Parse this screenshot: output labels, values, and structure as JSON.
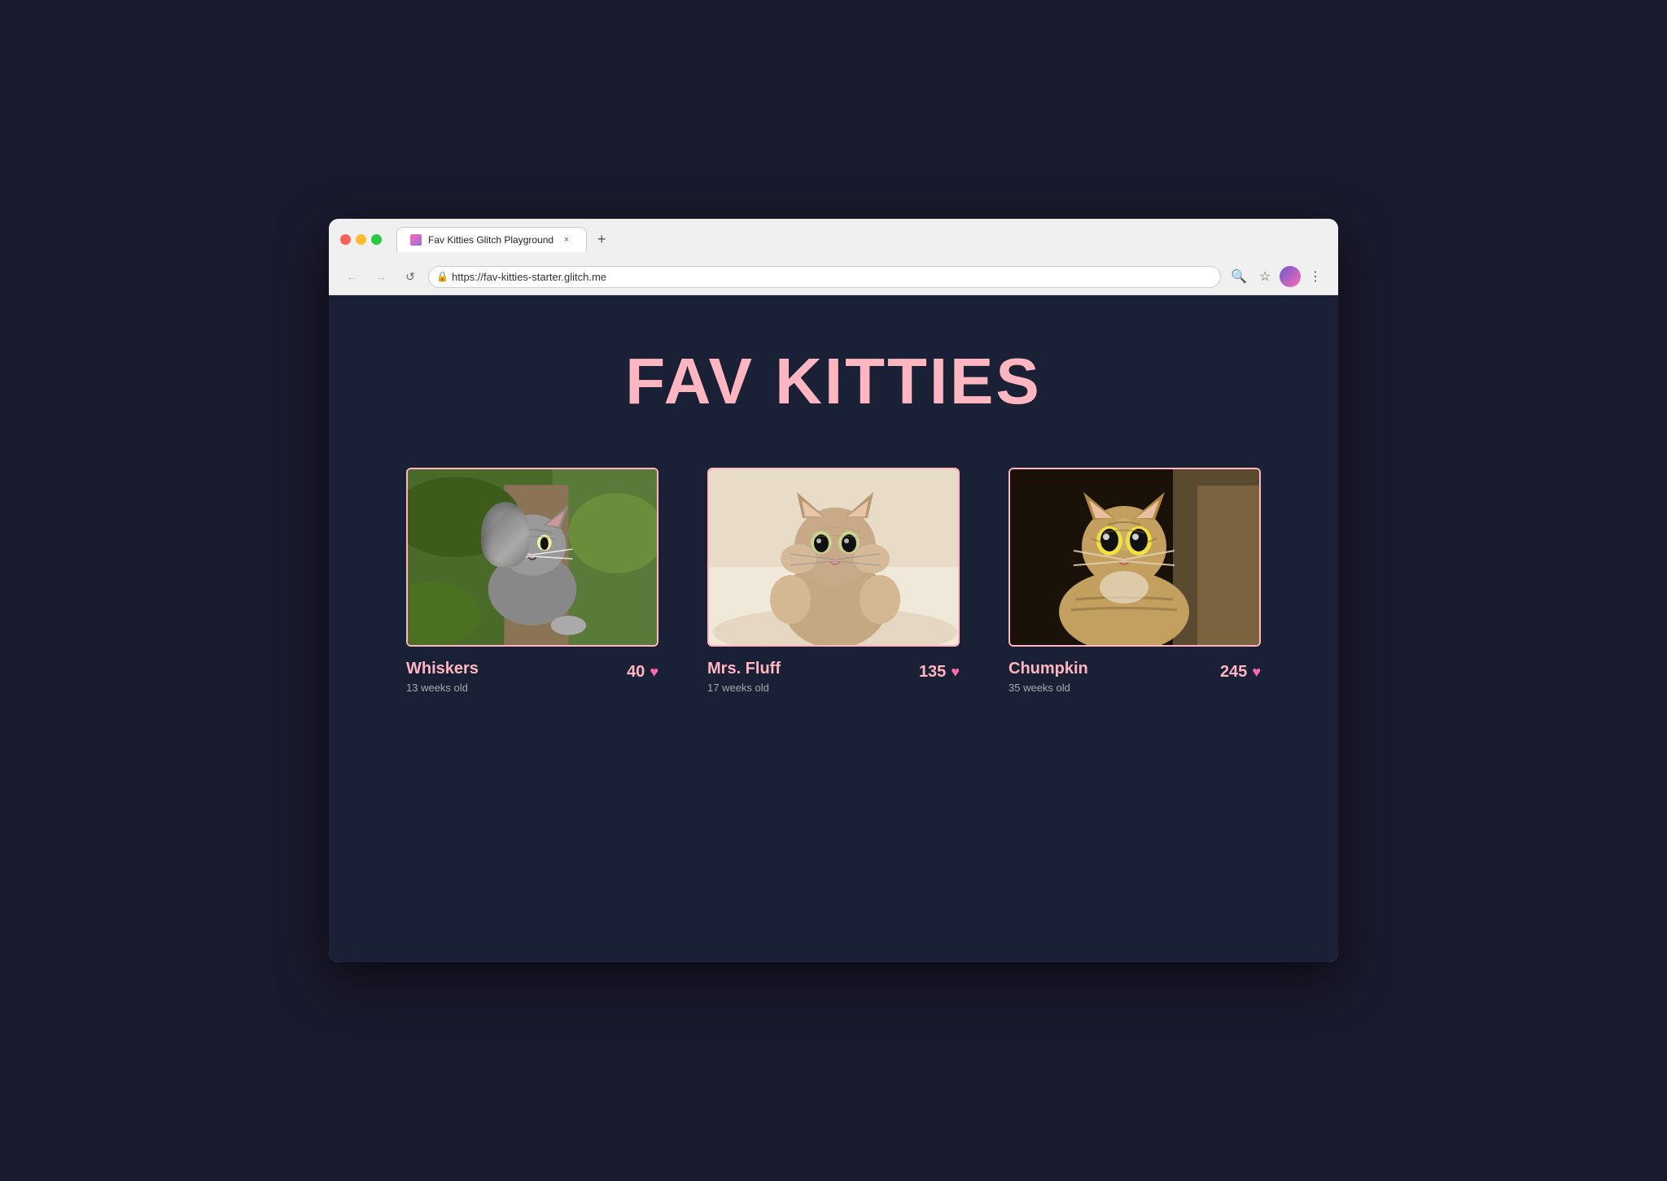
{
  "browser": {
    "tab_title": "Fav Kitties Glitch Playground",
    "tab_close_label": "×",
    "new_tab_label": "+",
    "url": "https://fav-kitties-starter.glitch.me",
    "lock_icon": "🔒",
    "nav": {
      "back": "←",
      "forward": "→",
      "reload": "↺"
    },
    "toolbar": {
      "search": "🔍",
      "bookmark": "☆",
      "menu": "⋮"
    }
  },
  "page": {
    "title": "FAV KITTIES",
    "kitties": [
      {
        "id": "whiskers",
        "name": "Whiskers",
        "age": "13 weeks old",
        "likes": 40,
        "theme": "cat-whiskers"
      },
      {
        "id": "mrs-fluff",
        "name": "Mrs. Fluff",
        "age": "17 weeks old",
        "likes": 135,
        "theme": "cat-fluff"
      },
      {
        "id": "chumpkin",
        "name": "Chumpkin",
        "age": "35 weeks old",
        "likes": 245,
        "theme": "cat-chumpkin"
      }
    ],
    "heart_symbol": "♥"
  },
  "colors": {
    "page_bg": "#1a2035",
    "title_color": "#ffb6c1",
    "card_border": "#ffb6c1",
    "name_color": "#ffb6c1",
    "age_color": "#aaaaaa",
    "likes_color": "#ffb6c1",
    "heart_color": "#ff69b4"
  }
}
